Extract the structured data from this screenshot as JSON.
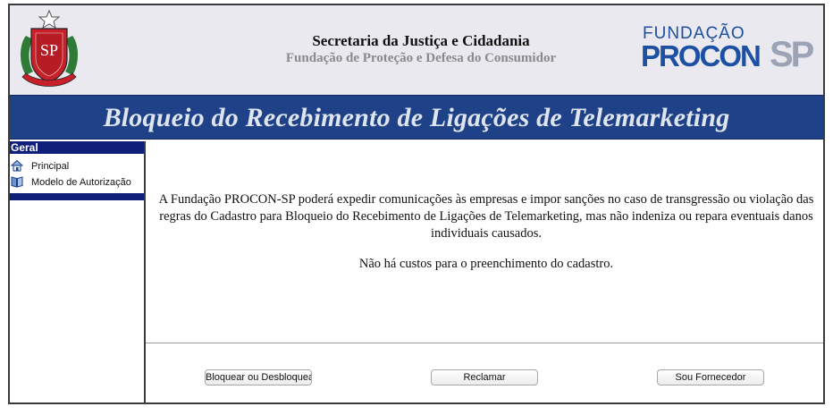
{
  "header": {
    "title": "Secretaria da Justiça e Cidadania",
    "subtitle": "Fundação de Proteção e Defesa do Consumidor",
    "seal_letters": "SP",
    "logo_top": "FUNDAÇÃO",
    "logo_main": "PROCON",
    "logo_sp": "SP"
  },
  "banner": {
    "title": "Bloqueio do Recebimento de Ligações de Telemarketing"
  },
  "sidebar": {
    "heading": "Geral",
    "items": [
      {
        "label": "Principal",
        "icon": "home-icon"
      },
      {
        "label": "Modelo de Autorização",
        "icon": "book-icon"
      }
    ]
  },
  "content": {
    "paragraph": "A Fundação PROCON-SP poderá expedir comunicações às empresas e impor sanções no caso de transgressão ou violação das regras do Cadastro para Bloqueio do Recebimento de Ligações de Telemarketing, mas não indeniza ou repara eventuais danos individuais causados.",
    "note": "Não há custos para o preenchimento do cadastro."
  },
  "buttons": {
    "block": "Bloquear ou Desbloquear",
    "complain": "Reclamar",
    "supplier": "Sou Fornecedor"
  },
  "colors": {
    "banner": "#1e4187",
    "sidebar_header": "#10207a",
    "logo_blue": "#1d4fa3",
    "header_bg": "#e9e9ef"
  }
}
